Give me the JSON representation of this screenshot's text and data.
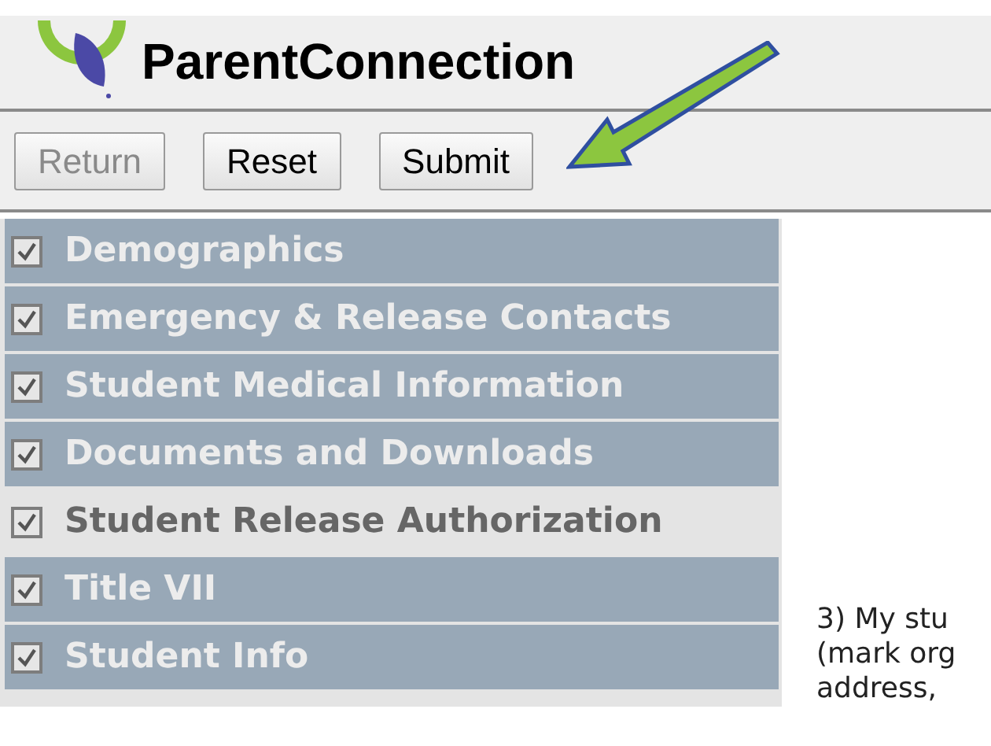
{
  "header": {
    "logo_text": "ParentConnection"
  },
  "toolbar": {
    "buttons": [
      {
        "label": "Return",
        "disabled": true
      },
      {
        "label": "Reset",
        "disabled": false
      },
      {
        "label": "Submit",
        "disabled": false
      }
    ]
  },
  "sidebar": {
    "items": [
      {
        "label": "Demographics",
        "checked": true,
        "selected": false
      },
      {
        "label": "Emergency & Release Contacts",
        "checked": true,
        "selected": false
      },
      {
        "label": "Student Medical Information",
        "checked": true,
        "selected": false
      },
      {
        "label": "Documents and Downloads",
        "checked": true,
        "selected": false
      },
      {
        "label": "Student Release Authorization",
        "checked": true,
        "selected": true
      },
      {
        "label": "Title VII",
        "checked": true,
        "selected": false
      },
      {
        "label": "Student Info",
        "checked": true,
        "selected": false
      }
    ]
  },
  "content": {
    "lines": [
      "3) My stu",
      "(mark org",
      "address,"
    ]
  }
}
